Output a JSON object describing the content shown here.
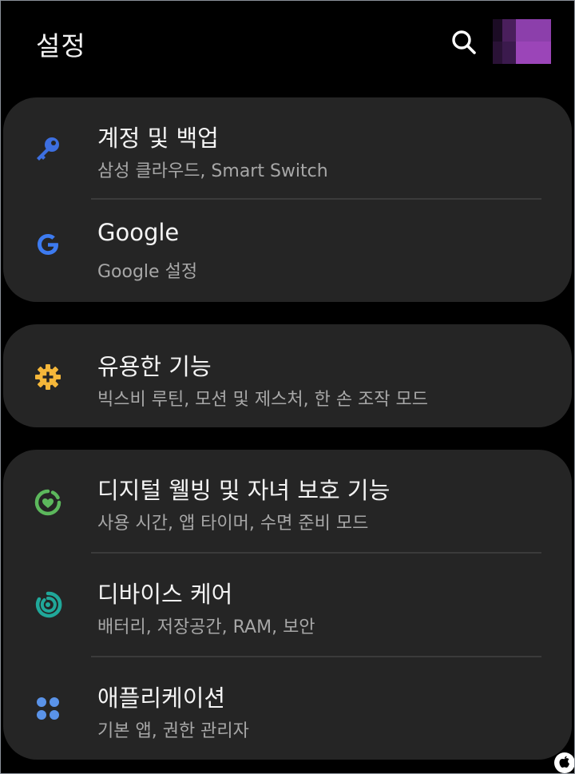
{
  "header": {
    "title": "설정",
    "search_icon": "search-icon",
    "avatar_colors": [
      "#4a1f5c",
      "#5a2a70",
      "#3b1a4d",
      "#7a3a95",
      "#9b45b8",
      "#8a3fa8"
    ]
  },
  "groups": [
    {
      "items": [
        {
          "title": "계정 및 백업",
          "subtitle": "삼성 클라우드, Smart Switch",
          "icon": "key-icon",
          "icon_color": "#3d6fe0"
        },
        {
          "title": "Google",
          "subtitle": "Google 설정",
          "icon": "google-g-icon",
          "icon_color": "#3d7bf0"
        }
      ]
    },
    {
      "items": [
        {
          "title": "유용한 기능",
          "subtitle": "빅스비 루틴, 모션 및 제스처, 한 손 조작 모드",
          "icon": "gear-plus-icon",
          "icon_color": "#f5b73a"
        }
      ]
    },
    {
      "items": [
        {
          "title": "디지털 웰빙 및 자녀 보호 기능",
          "subtitle": "사용 시간, 앱 타이머, 수면 준비 모드",
          "icon": "digital-wellbeing-icon",
          "icon_color": "#5cb85c"
        },
        {
          "title": "디바이스 케어",
          "subtitle": "배터리, 저장공간, RAM, 보안",
          "icon": "device-care-icon",
          "icon_color": "#20a89a"
        },
        {
          "title": "애플리케이션",
          "subtitle": "기본 앱, 권한 관리자",
          "icon": "apps-grid-icon",
          "icon_color": "#5a93e8"
        }
      ]
    }
  ],
  "colors": {
    "background": "#000000",
    "card": "#252525",
    "divider": "#3b3b3b",
    "title_text": "#f4f4f4",
    "subtitle_text": "#a7a7a7"
  }
}
